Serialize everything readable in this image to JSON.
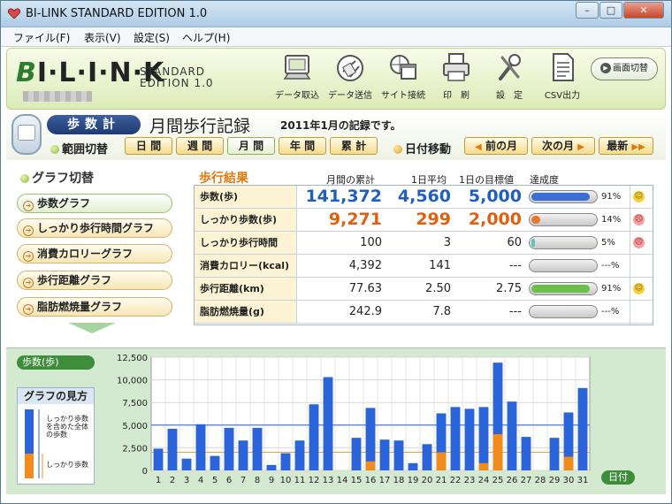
{
  "window": {
    "title": "BI-LINK STANDARD EDITION 1.0",
    "minimize": "–",
    "maximize": "□",
    "close": "✕"
  },
  "menu": [
    "ファイル(F)",
    "表示(V)",
    "設定(S)",
    "ヘルプ(H)"
  ],
  "header": {
    "logo": {
      "b": "B",
      "rest": "I·L·I·N·K"
    },
    "edition_line1": "STANDARD",
    "edition_line2": "EDITION 1.0",
    "tools": [
      {
        "label": "データ取込",
        "icon": "data-import-icon"
      },
      {
        "label": "データ送信",
        "icon": "data-send-icon"
      },
      {
        "label": "サイト接続",
        "icon": "site-connect-icon"
      },
      {
        "label": "印　刷",
        "icon": "printer-icon"
      },
      {
        "label": "設　定",
        "icon": "settings-tools-icon"
      },
      {
        "label": "CSV出力",
        "icon": "csv-export-icon"
      }
    ],
    "screen_switch": "画面切替",
    "screen_switch_icon": "▶"
  },
  "nav": {
    "mode": "歩数計",
    "page_title": "月間歩行記録",
    "period_note": "2011年1月の記録です。",
    "range_label": "範囲切替",
    "ranges": [
      "日 間",
      "週 間",
      "月 間",
      "年 間",
      "累 計"
    ],
    "date_move_label": "日付移動",
    "prev": "前の月",
    "next": "次の月",
    "latest": "最新",
    "prev_arrow": "◀",
    "next_arrow": "▶",
    "latest_arrow": "▶▶"
  },
  "graph_switch": {
    "title": "グラフ切替",
    "arrow": "➔",
    "items": [
      "歩数グラフ",
      "しっかり歩行時間グラフ",
      "消費カロリーグラフ",
      "歩行距離グラフ",
      "脂肪燃焼量グラフ"
    ]
  },
  "results": {
    "title": "歩行結果",
    "columns": [
      "月間の累計",
      "1日平均",
      "1日の目標値",
      "達成度"
    ],
    "rows": [
      {
        "name": "歩数(歩)",
        "total": "141,372",
        "avg": "4,560",
        "target": "5,000",
        "pct": "91%",
        "pct_value": 91,
        "bar_color": "#3a6fd8",
        "face": "smile",
        "face_glyph": "☺",
        "style": "blue"
      },
      {
        "name": "しっかり歩数(歩)",
        "total": "9,271",
        "avg": "299",
        "target": "2,000",
        "pct": "14%",
        "pct_value": 14,
        "bar_color": "#e8782a",
        "face": "frown",
        "face_glyph": "☹",
        "style": "orange"
      },
      {
        "name": "しっかり歩行時間(分)",
        "total": "100",
        "avg": "3",
        "target": "60",
        "pct": "5%",
        "pct_value": 5,
        "bar_color": "#5fc4c0",
        "face": "frown",
        "face_glyph": "☹",
        "style": "plain"
      },
      {
        "name": "消費カロリー(kcal)",
        "total": "4,392",
        "avg": "141",
        "target": "---",
        "pct": "---%",
        "pct_value": 0,
        "bar_color": "#999999",
        "face": "",
        "face_glyph": "",
        "style": "plain"
      },
      {
        "name": "歩行距離(km)",
        "total": "77.63",
        "avg": "2.50",
        "target": "2.75",
        "pct": "91%",
        "pct_value": 91,
        "bar_color": "#6cc04a",
        "face": "smile",
        "face_glyph": "☺",
        "style": "plain"
      },
      {
        "name": "脂肪燃焼量(g)",
        "total": "242.9",
        "avg": "7.8",
        "target": "---",
        "pct": "---%",
        "pct_value": 0,
        "bar_color": "#999999",
        "face": "",
        "face_glyph": "",
        "style": "plain"
      }
    ]
  },
  "bottom": {
    "series_label": "歩数(歩)",
    "legend_title": "グラフの見方",
    "legend_note1": "しっかり歩数を含めた全体の歩数",
    "legend_note2": "しっかり歩数",
    "x_axis_label": "日付"
  },
  "colors": {
    "steps": "#2b63d9",
    "vigorous": "#f08c1e",
    "target_line": "#2b63d9",
    "avg_line": "#e8a040"
  },
  "chart_data": {
    "type": "bar",
    "x": [
      1,
      2,
      3,
      4,
      5,
      6,
      7,
      8,
      9,
      10,
      11,
      12,
      13,
      14,
      15,
      16,
      17,
      18,
      19,
      20,
      21,
      22,
      23,
      24,
      25,
      26,
      27,
      28,
      29,
      30,
      31
    ],
    "series": [
      {
        "values": [
          2400,
          4600,
          1300,
          5100,
          1600,
          4700,
          3300,
          4700,
          600,
          1900,
          3300,
          7300,
          10300,
          0,
          3600,
          6900,
          3400,
          3300,
          800,
          2900,
          6300,
          7000,
          6800,
          7000,
          11900,
          7600,
          3700,
          0,
          3600,
          6400,
          9100
        ]
      },
      {
        "values": [
          0,
          0,
          0,
          0,
          0,
          0,
          0,
          0,
          0,
          0,
          0,
          0,
          0,
          0,
          0,
          1000,
          0,
          0,
          0,
          0,
          2000,
          0,
          0,
          800,
          4000,
          0,
          0,
          0,
          0,
          1500,
          0
        ]
      }
    ],
    "ylim": [
      0,
      12500
    ],
    "yticks": [
      "0",
      "2,500",
      "5,000",
      "7,500",
      "10,000",
      "12,500"
    ],
    "target_line": 5000,
    "avg_line": 2000,
    "grid": true
  }
}
